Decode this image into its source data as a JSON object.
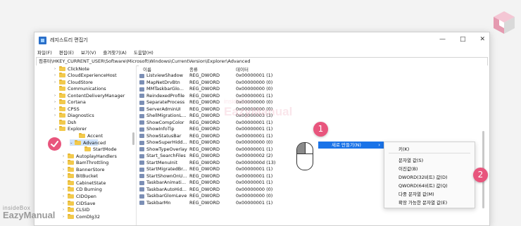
{
  "window": {
    "title": "레지스트리 편집기",
    "controls": {
      "minimize": "—",
      "maximize": "□",
      "close": "✕"
    }
  },
  "menu": [
    "파일(F)",
    "편집(E)",
    "보기(V)",
    "즐겨찾기(A)",
    "도움말(H)"
  ],
  "address": "컴퓨터\\HKEY_CURRENT_USER\\Software\\Microsoft\\Windows\\CurrentVersion\\Explorer\\Advanced",
  "tree": {
    "items": [
      {
        "label": "ClickNote",
        "arrow": ">"
      },
      {
        "label": "CloudExperienceHost",
        "arrow": ">"
      },
      {
        "label": "CloudStore",
        "arrow": ">"
      },
      {
        "label": "Communications",
        "arrow": ""
      },
      {
        "label": "ContentDeliveryManager",
        "arrow": ">"
      },
      {
        "label": "Cortana",
        "arrow": ">"
      },
      {
        "label": "CPSS",
        "arrow": ">"
      },
      {
        "label": "Diagnostics",
        "arrow": ">"
      },
      {
        "label": "Dsh",
        "arrow": ""
      },
      {
        "label": "Explorer",
        "arrow": "v"
      },
      {
        "label": "Accent",
        "arrow": ""
      },
      {
        "label": "Advanced",
        "arrow": "v"
      },
      {
        "label": "StartMode",
        "arrow": ""
      },
      {
        "label": "AutoplayHandlers",
        "arrow": ">"
      },
      {
        "label": "BamThrottling",
        "arrow": ">"
      },
      {
        "label": "BannerStore",
        "arrow": ">"
      },
      {
        "label": "BitBucket",
        "arrow": ">"
      },
      {
        "label": "CabinetState",
        "arrow": ""
      },
      {
        "label": "CD Burning",
        "arrow": ">"
      },
      {
        "label": "CIDOpen",
        "arrow": ">"
      },
      {
        "label": "CIDSave",
        "arrow": ">"
      },
      {
        "label": "CLSID",
        "arrow": ">"
      },
      {
        "label": "ComDlg32",
        "arrow": ">"
      }
    ]
  },
  "columns": {
    "name": "이름",
    "type": "종류",
    "data": "데이터"
  },
  "values": [
    {
      "name": "ListviewShadow",
      "type": "REG_DWORD",
      "data": "0x00000001 (1)"
    },
    {
      "name": "MapNetDrvBtn",
      "type": "REG_DWORD",
      "data": "0x00000000 (0)"
    },
    {
      "name": "MMTaskbarGlo...",
      "type": "REG_DWORD",
      "data": "0x00000000 (0)"
    },
    {
      "name": "ReindexedProfile",
      "type": "REG_DWORD",
      "data": "0x00000001 (1)"
    },
    {
      "name": "SeparateProcess",
      "type": "REG_DWORD",
      "data": "0x00000000 (0)"
    },
    {
      "name": "ServerAdminUI",
      "type": "REG_DWORD",
      "data": "0x00000000 (0)"
    },
    {
      "name": "ShellMigrationL...",
      "type": "REG_DWORD",
      "data": "0x00000003 (3)"
    },
    {
      "name": "ShowCompColor",
      "type": "REG_DWORD",
      "data": "0x00000001 (1)"
    },
    {
      "name": "ShowInfoTip",
      "type": "REG_DWORD",
      "data": "0x00000001 (1)"
    },
    {
      "name": "ShowStatusBar",
      "type": "REG_DWORD",
      "data": "0x00000001 (1)"
    },
    {
      "name": "ShowSuperHidd...",
      "type": "REG_DWORD",
      "data": "0x00000000 (0)"
    },
    {
      "name": "ShowTypeOverlay",
      "type": "REG_DWORD",
      "data": "0x00000001 (1)"
    },
    {
      "name": "Start_SearchFiles",
      "type": "REG_DWORD",
      "data": "0x00000002 (2)"
    },
    {
      "name": "StartMenuInit",
      "type": "REG_DWORD",
      "data": "0x0000000d (13)"
    },
    {
      "name": "StartMigratedBr...",
      "type": "REG_DWORD",
      "data": "0x00000001 (1)"
    },
    {
      "name": "StartShownOnU...",
      "type": "REG_DWORD",
      "data": "0x00000001 (1)"
    },
    {
      "name": "TaskbarAnimati...",
      "type": "REG_DWORD",
      "data": "0x00000001 (1)"
    },
    {
      "name": "TaskbarAutoHid...",
      "type": "REG_DWORD",
      "data": "0x00000000 (0)"
    },
    {
      "name": "TaskbarGlomLevel",
      "type": "REG_DWORD",
      "data": "0x00000000 (0)"
    },
    {
      "name": "TaskbarMn",
      "type": "REG_DWORD",
      "data": "0x00000001 (1)"
    }
  ],
  "context_menu": {
    "new_label": "새로 만들기(N)",
    "new_chevron": "›",
    "submenu": [
      "키(K)",
      "문자열 값(S)",
      "이진값(B)",
      "DWORD(32비트) 값(D)",
      "QWORD(64비트) 값(Q)",
      "다중 문자열 값(M)",
      "확장 가능한 문자열 값(E)"
    ]
  },
  "badges": {
    "step1": "1",
    "step2": "2"
  },
  "watermark": {
    "small": "insideBox",
    "big": "EazyManual"
  },
  "colors": {
    "accent": "#1a73e8",
    "badge": "#e8557d",
    "selection": "#cfe3fb"
  }
}
